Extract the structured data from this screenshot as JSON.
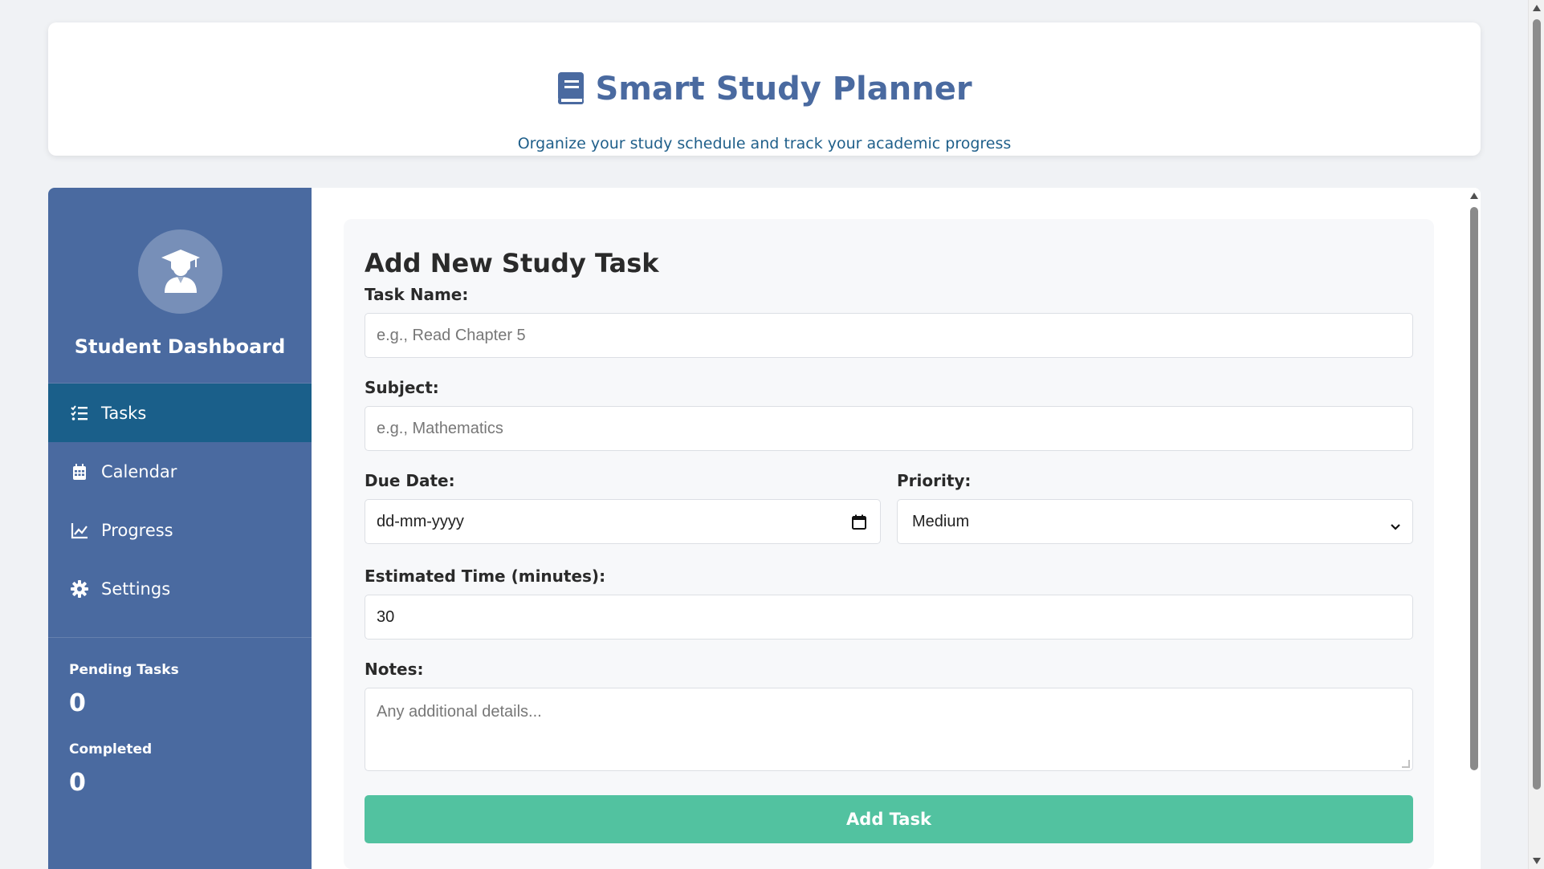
{
  "header": {
    "title": "Smart Study Planner",
    "subtitle": "Organize your study schedule and track your academic progress",
    "icon": "book-icon"
  },
  "sidebar": {
    "title": "Student Dashboard",
    "avatar_icon": "graduate-icon",
    "items": [
      {
        "label": "Tasks",
        "icon": "tasks-list-icon",
        "active": true
      },
      {
        "label": "Calendar",
        "icon": "calendar-icon",
        "active": false
      },
      {
        "label": "Progress",
        "icon": "chart-line-icon",
        "active": false
      },
      {
        "label": "Settings",
        "icon": "gear-icon",
        "active": false
      }
    ],
    "stats": {
      "pending_label": "Pending Tasks",
      "pending_value": "0",
      "completed_label": "Completed",
      "completed_value": "0"
    }
  },
  "form": {
    "title": "Add New Study Task",
    "task_name": {
      "label": "Task Name:",
      "placeholder": "e.g., Read Chapter 5",
      "value": ""
    },
    "subject": {
      "label": "Subject:",
      "placeholder": "e.g., Mathematics",
      "value": ""
    },
    "due_date": {
      "label": "Due Date:",
      "placeholder": "dd-mm-yyyy"
    },
    "priority": {
      "label": "Priority:",
      "value": "Medium"
    },
    "estimated_time": {
      "label": "Estimated Time (minutes):",
      "value": "30"
    },
    "notes": {
      "label": "Notes:",
      "placeholder": "Any additional details..."
    },
    "submit_label": "Add Task"
  },
  "colors": {
    "primary": "#4a6aa0",
    "active_nav": "#1a5f8a",
    "button": "#52c2a0",
    "page_bg": "#f0f2f5"
  }
}
